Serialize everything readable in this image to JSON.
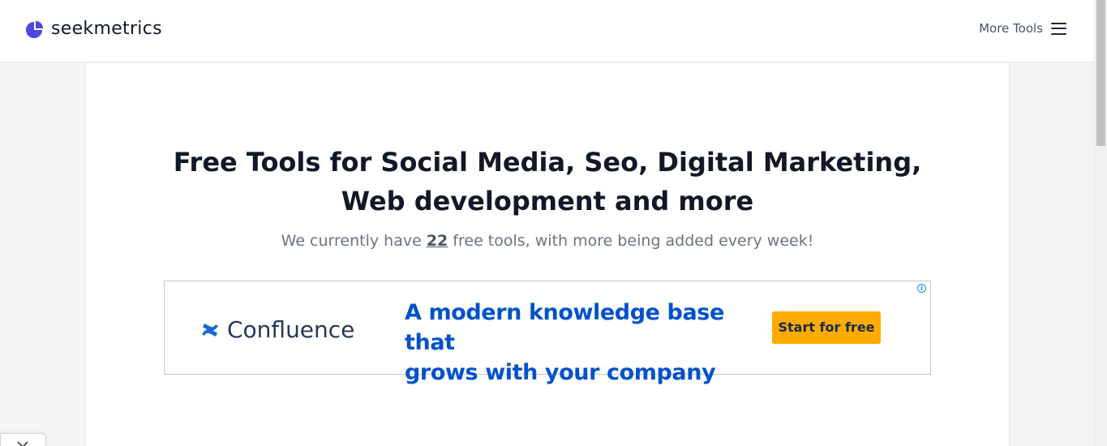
{
  "header": {
    "brand": "seekmetrics",
    "more_tools_label": "More Tools"
  },
  "hero": {
    "title_line1": "Free Tools for Social Media, Seo, Digital Marketing,",
    "title_line2": "Web development and more",
    "subtitle_before": "We currently have ",
    "tool_count": "22",
    "subtitle_after": " free tools, with more being added every week!"
  },
  "ad": {
    "brand_name": "Confluence",
    "headline_line1": "A modern knowledge base that",
    "headline_line2": "grows with your company",
    "cta_label": "Start for free",
    "info_glyph": "i"
  },
  "colors": {
    "brand_accent": "#4f46e5",
    "ad_blue": "#0052cc",
    "ad_cta": "#ffab00"
  },
  "icons": {
    "logo": "pie-chart-icon",
    "menu": "hamburger-menu-icon",
    "ad_brand": "confluence-logo-icon",
    "ad_info": "info-icon",
    "close": "close-icon"
  }
}
